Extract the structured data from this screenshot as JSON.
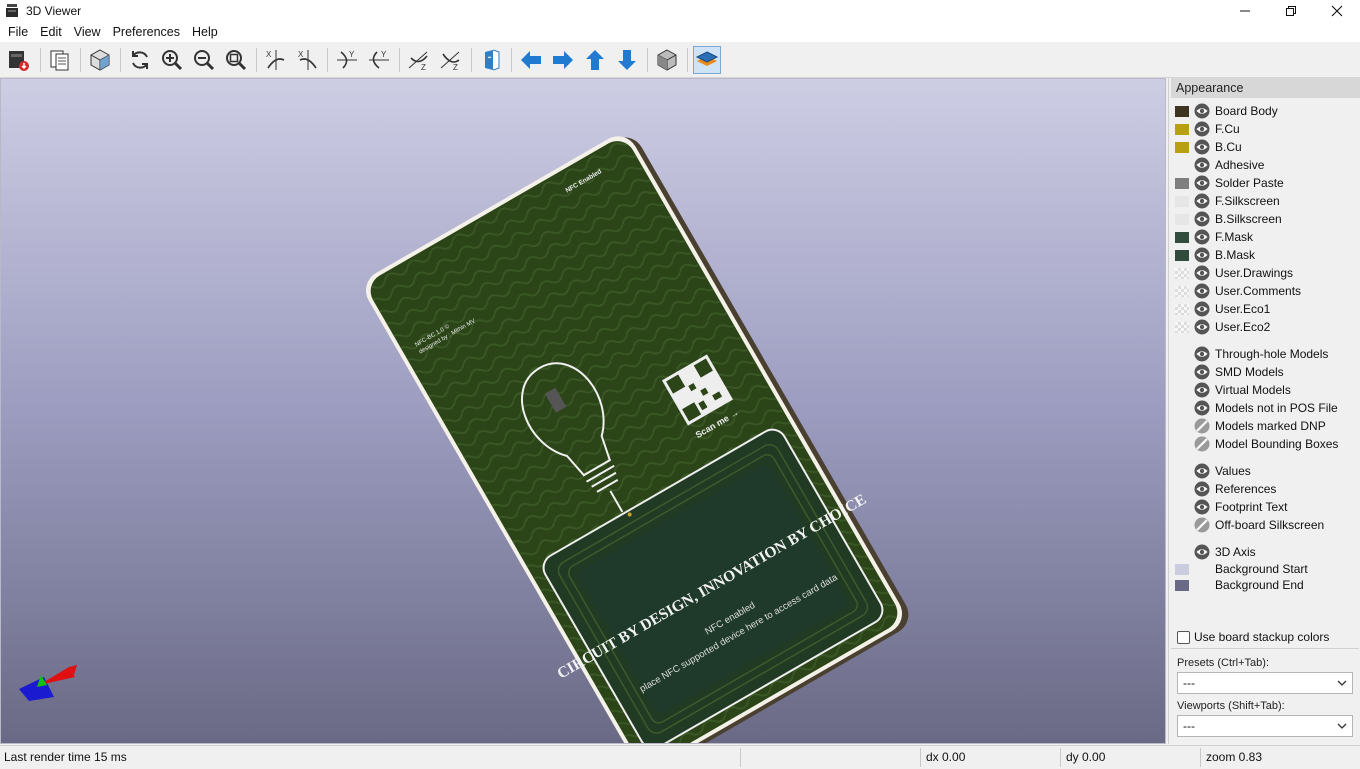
{
  "window": {
    "title": "3D Viewer"
  },
  "menu": [
    "File",
    "Edit",
    "View",
    "Preferences",
    "Help"
  ],
  "toolbar": [
    {
      "name": "render-raytracing-button",
      "icon": "render-icon"
    },
    {
      "name": "copy-to-clipboard-button",
      "icon": "clipboard-icon"
    },
    {
      "name": "realistic-mode-button",
      "icon": "box-icon"
    },
    {
      "name": "reload-board-button",
      "icon": "refresh-icon"
    },
    {
      "name": "zoom-in-button",
      "icon": "zoom-in-icon"
    },
    {
      "name": "zoom-out-button",
      "icon": "zoom-out-icon"
    },
    {
      "name": "zoom-fit-button",
      "icon": "zoom-fit-icon"
    },
    {
      "name": "rotate-x-cw-button",
      "icon": "rotate-x-icon"
    },
    {
      "name": "rotate-x-ccw-button",
      "icon": "rotate-x-icon"
    },
    {
      "name": "rotate-y-cw-button",
      "icon": "rotate-y-icon"
    },
    {
      "name": "rotate-y-ccw-button",
      "icon": "rotate-y-icon"
    },
    {
      "name": "rotate-z-cw-button",
      "icon": "rotate-z-icon"
    },
    {
      "name": "rotate-z-ccw-button",
      "icon": "rotate-z-icon"
    },
    {
      "name": "flip-board-button",
      "icon": "flip-icon"
    },
    {
      "name": "move-left-button",
      "icon": "arrow-left-icon"
    },
    {
      "name": "move-right-button",
      "icon": "arrow-right-icon"
    },
    {
      "name": "move-up-button",
      "icon": "arrow-up-icon"
    },
    {
      "name": "move-down-button",
      "icon": "arrow-down-icon"
    },
    {
      "name": "orthographic-button",
      "icon": "cube-icon"
    },
    {
      "name": "toggle-layers-panel-button",
      "icon": "layers-icon"
    }
  ],
  "board": {
    "slogan": "CIRCUIT BY DESIGN, INNOVATION BY CHOICE",
    "nfc_line1": "NFC enabled",
    "nfc_line2": "place NFC supported device here to access card data",
    "scan_label": "Scan me →",
    "corner_label": "NFC Enabled",
    "version_label": "NFC-BC 1.0 ©",
    "designer_label": "designed by : Mithin MV"
  },
  "appearance": {
    "header": "Appearance",
    "layers": [
      {
        "label": "Board Body",
        "color": "#3d3522",
        "swatch": "solid"
      },
      {
        "label": "F.Cu",
        "color": "#b8a013",
        "swatch": "solid"
      },
      {
        "label": "B.Cu",
        "color": "#b8a013",
        "swatch": "solid"
      },
      {
        "label": "Adhesive",
        "color": "",
        "swatch": "empty"
      },
      {
        "label": "Solder Paste",
        "color": "#7f7f7f",
        "swatch": "solid"
      },
      {
        "label": "F.Silkscreen",
        "color": "#e6e6e6",
        "swatch": "solid"
      },
      {
        "label": "B.Silkscreen",
        "color": "#e6e6e6",
        "swatch": "solid"
      },
      {
        "label": "F.Mask",
        "color": "#314c3c",
        "swatch": "solid"
      },
      {
        "label": "B.Mask",
        "color": "#314c3c",
        "swatch": "solid"
      },
      {
        "label": "User.Drawings",
        "color": "",
        "swatch": "checker"
      },
      {
        "label": "User.Comments",
        "color": "",
        "swatch": "checker"
      },
      {
        "label": "User.Eco1",
        "color": "",
        "swatch": "checker"
      },
      {
        "label": "User.Eco2",
        "color": "",
        "swatch": "checker"
      }
    ],
    "models": [
      {
        "label": "Through-hole Models",
        "visible": true
      },
      {
        "label": "SMD Models",
        "visible": true
      },
      {
        "label": "Virtual Models",
        "visible": true
      },
      {
        "label": "Models not in POS File",
        "visible": true
      },
      {
        "label": "Models marked DNP",
        "visible": false
      },
      {
        "label": "Model Bounding Boxes",
        "visible": false
      }
    ],
    "texts": [
      {
        "label": "Values",
        "visible": true
      },
      {
        "label": "References",
        "visible": true
      },
      {
        "label": "Footprint Text",
        "visible": true
      },
      {
        "label": "Off-board Silkscreen",
        "visible": false
      }
    ],
    "misc": {
      "axis_label": "3D Axis",
      "bg_start_label": "Background Start",
      "bg_start_color": "#ccccdf",
      "bg_end_label": "Background End",
      "bg_end_color": "#6a6a86"
    },
    "stackup_label": "Use board stackup colors",
    "presets_label": "Presets (Ctrl+Tab):",
    "presets_value": "---",
    "viewports_label": "Viewports (Shift+Tab):",
    "viewports_value": "---"
  },
  "status": {
    "render_time": "Last render time 15 ms",
    "dx": "dx 0.00",
    "dy": "dy 0.00",
    "zoom": "zoom 0.83"
  }
}
